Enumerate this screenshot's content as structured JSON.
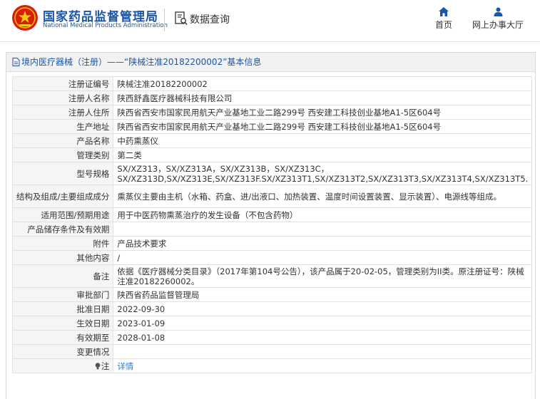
{
  "header": {
    "site_title": "国家药品监督管理局",
    "site_subtitle": "National Medical Products Administration",
    "page_name": "数据查询",
    "nav": [
      {
        "label": "首页",
        "icon": "home-icon"
      },
      {
        "label": "网上办事大厅",
        "icon": "user-icon"
      }
    ]
  },
  "panel": {
    "title": "境内医疗器械（注册）——“陕械注准20182200002”基本信息"
  },
  "rows": [
    {
      "label": "注册证编号",
      "value": "陕械注准20182200002"
    },
    {
      "label": "注册人名称",
      "value": "陕西舒鑫医疗器械科技有限公司"
    },
    {
      "label": "注册人住所",
      "value": "陕西省西安市国家民用航天产业基地工业二路299号 西安建工科技创业基地A1-5区604号"
    },
    {
      "label": "生产地址",
      "value": "陕西省西安市国家民用航天产业基地工业二路299号 西安建工科技创业基地A1-5区604号"
    },
    {
      "label": "产品名称",
      "value": "中药熏蒸仪"
    },
    {
      "label": "管理类别",
      "value": "第二类"
    },
    {
      "label": "型号规格",
      "value": "SX/XZ313，SX/XZ313A，SX/XZ313B，SX/XZ313C，SX/XZ313D,SX/XZ313E,SX/XZ313F.SX/XZ313T1,SX/XZ313T2,SX/XZ313T3,SX/XZ313T4,SX/XZ313T5."
    },
    {
      "label": "结构及组成/主要组成成分",
      "value": "熏蒸仪主要由主机（水箱、药盒、进/出液口、加热装置、温度时间设置装置、显示装置）、电源线等组成。"
    },
    {
      "label": "适用范围/预期用途",
      "value": "用于中医药物熏蒸治疗的发生设备（不包含药物）"
    },
    {
      "label": "产品储存条件及有效期",
      "value": ""
    },
    {
      "label": "附件",
      "value": "产品技术要求"
    },
    {
      "label": "其他内容",
      "value": "/"
    },
    {
      "label": "备注",
      "value": "依据《医疗器械分类目录》（2017年第104号公告），该产品属于20-02-05，管理类别为II类。原注册证号：陕械注准20182260002。"
    },
    {
      "label": "审批部门",
      "value": "陕西省药品监督管理局"
    },
    {
      "label": "批准日期",
      "value": "2022-09-30"
    },
    {
      "label": "生效日期",
      "value": "2023-01-09"
    },
    {
      "label": "有效期至",
      "value": "2028-01-08"
    },
    {
      "label": "变更情况",
      "value": ""
    },
    {
      "label": "注",
      "value": "详情"
    }
  ]
}
